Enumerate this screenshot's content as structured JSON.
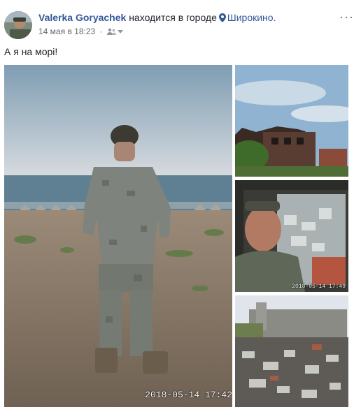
{
  "post": {
    "author": "Valerka Goryachek",
    "location_prefix": "находится в городе",
    "location_city": "Широкино.",
    "timestamp": "14 мая в 18:23",
    "separator": "·",
    "text": "А я на морі!",
    "more_label": "···"
  },
  "photos": [
    {
      "stamp": "2018-05-14  17:42"
    },
    {
      "stamp": ""
    },
    {
      "stamp": "2018-05-14  17:49"
    },
    {
      "stamp": ""
    }
  ],
  "colors": {
    "link": "#365899",
    "meta": "#616770",
    "text": "#1d2129"
  },
  "icons": {
    "location": "map-pin-icon",
    "audience": "friends-icon",
    "dropdown": "caret-down-icon",
    "more": "ellipsis-icon"
  }
}
